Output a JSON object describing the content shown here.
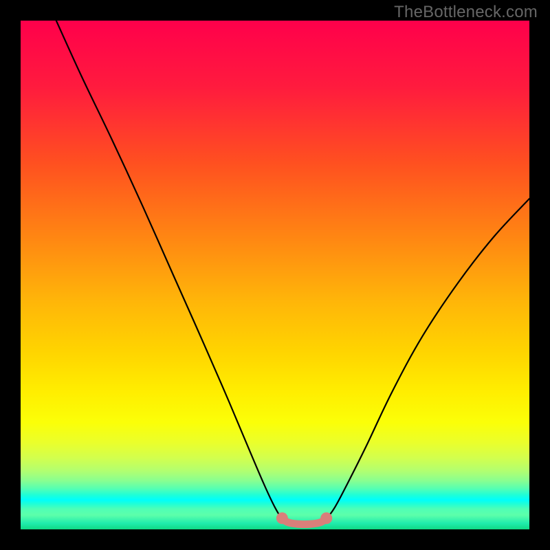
{
  "watermark": {
    "text": "TheBottleneck.com"
  },
  "chart_data": {
    "type": "line",
    "title": "",
    "xlabel": "",
    "ylabel": "",
    "xlim": [
      0,
      100
    ],
    "ylim": [
      0,
      100
    ],
    "gradient_stops": [
      {
        "offset": 0,
        "color": "#ff004b"
      },
      {
        "offset": 13,
        "color": "#ff1b3e"
      },
      {
        "offset": 28,
        "color": "#ff5020"
      },
      {
        "offset": 42,
        "color": "#ff8413"
      },
      {
        "offset": 55,
        "color": "#ffb509"
      },
      {
        "offset": 65,
        "color": "#ffd400"
      },
      {
        "offset": 73,
        "color": "#ffee00"
      },
      {
        "offset": 79,
        "color": "#fbff08"
      },
      {
        "offset": 83,
        "color": "#eaff2c"
      },
      {
        "offset": 86,
        "color": "#d2ff4e"
      },
      {
        "offset": 88.5,
        "color": "#b2ff70"
      },
      {
        "offset": 90.5,
        "color": "#87ff92"
      },
      {
        "offset": 92,
        "color": "#55ffb3"
      },
      {
        "offset": 93.2,
        "color": "#20ffd6"
      },
      {
        "offset": 94.2,
        "color": "#00fffb"
      },
      {
        "offset": 95,
        "color": "#20ffd6"
      },
      {
        "offset": 96,
        "color": "#4fffb6"
      },
      {
        "offset": 97.2,
        "color": "#5cffaa"
      },
      {
        "offset": 98.8,
        "color": "#20ecad"
      },
      {
        "offset": 100,
        "color": "#10d885"
      }
    ],
    "series": [
      {
        "name": "bottleneck-curve",
        "color": "#000000",
        "points": [
          {
            "x": 7.0,
            "y": 100.0
          },
          {
            "x": 12.0,
            "y": 89.0
          },
          {
            "x": 18.0,
            "y": 76.5
          },
          {
            "x": 24.0,
            "y": 63.5
          },
          {
            "x": 30.0,
            "y": 50.0
          },
          {
            "x": 36.0,
            "y": 36.5
          },
          {
            "x": 41.0,
            "y": 25.0
          },
          {
            "x": 45.0,
            "y": 15.5
          },
          {
            "x": 48.0,
            "y": 8.5
          },
          {
            "x": 50.0,
            "y": 4.3
          },
          {
            "x": 51.4,
            "y": 2.2
          },
          {
            "x": 53.0,
            "y": 1.3
          },
          {
            "x": 56.0,
            "y": 1.0
          },
          {
            "x": 58.8,
            "y": 1.3
          },
          {
            "x": 60.1,
            "y": 2.2
          },
          {
            "x": 61.8,
            "y": 4.4
          },
          {
            "x": 64.5,
            "y": 9.5
          },
          {
            "x": 68.0,
            "y": 16.5
          },
          {
            "x": 73.0,
            "y": 27.0
          },
          {
            "x": 79.0,
            "y": 38.0
          },
          {
            "x": 86.0,
            "y": 48.5
          },
          {
            "x": 93.0,
            "y": 57.5
          },
          {
            "x": 100.0,
            "y": 65.0
          }
        ]
      },
      {
        "name": "optimal-flat-segment",
        "color": "#d97f7a",
        "thickness": "thick",
        "points": [
          {
            "x": 51.4,
            "y": 2.2
          },
          {
            "x": 52.5,
            "y": 1.4
          },
          {
            "x": 54.5,
            "y": 1.05
          },
          {
            "x": 57.0,
            "y": 1.05
          },
          {
            "x": 59.0,
            "y": 1.4
          },
          {
            "x": 60.1,
            "y": 2.2
          }
        ],
        "endpoints": [
          {
            "x": 51.4,
            "y": 2.2
          },
          {
            "x": 60.1,
            "y": 2.2
          }
        ]
      }
    ]
  }
}
